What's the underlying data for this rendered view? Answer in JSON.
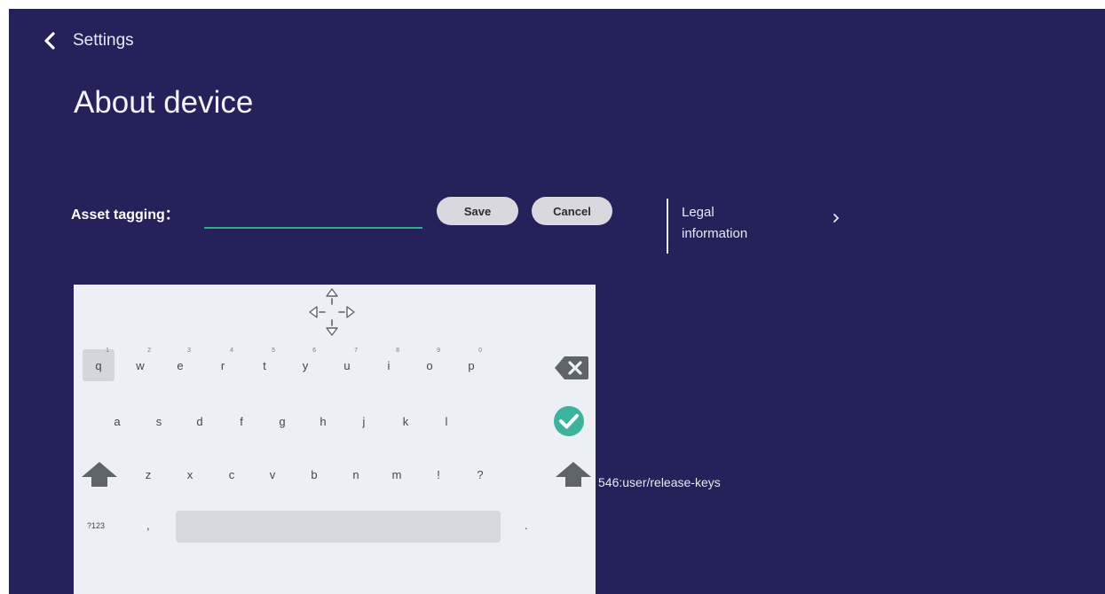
{
  "header": {
    "breadcrumb": "Settings",
    "title": "About device"
  },
  "asset": {
    "label": "Asset tagging：",
    "value": "",
    "save_label": "Save",
    "cancel_label": "Cancel"
  },
  "legal": {
    "line1": "Legal",
    "line2": "information",
    "chevron": "›"
  },
  "build_text": "546:user/release-keys",
  "keyboard": {
    "row1": [
      {
        "k": "q",
        "h": "1"
      },
      {
        "k": "w",
        "h": "2"
      },
      {
        "k": "e",
        "h": "3"
      },
      {
        "k": "r",
        "h": "4"
      },
      {
        "k": "t",
        "h": "5"
      },
      {
        "k": "y",
        "h": "6"
      },
      {
        "k": "u",
        "h": "7"
      },
      {
        "k": "i",
        "h": "8"
      },
      {
        "k": "o",
        "h": "9"
      },
      {
        "k": "p",
        "h": "0"
      }
    ],
    "row2": [
      "a",
      "s",
      "d",
      "f",
      "g",
      "h",
      "j",
      "k",
      "l"
    ],
    "row3": [
      "z",
      "x",
      "c",
      "v",
      "b",
      "n",
      "m",
      "!",
      "?"
    ],
    "symbols_key": "?123",
    "comma_key": ",",
    "period_key": ".",
    "icons": {
      "move": "move-arrows-icon",
      "backspace": "backspace-icon",
      "enter": "checkmark-icon",
      "shift": "shift-arrow-icon",
      "back": "chevron-left-icon"
    }
  },
  "colors": {
    "background": "#25215a",
    "accent": "#2fae86",
    "keyboard_bg": "#eceff3",
    "enter_key": "#3db39e"
  }
}
